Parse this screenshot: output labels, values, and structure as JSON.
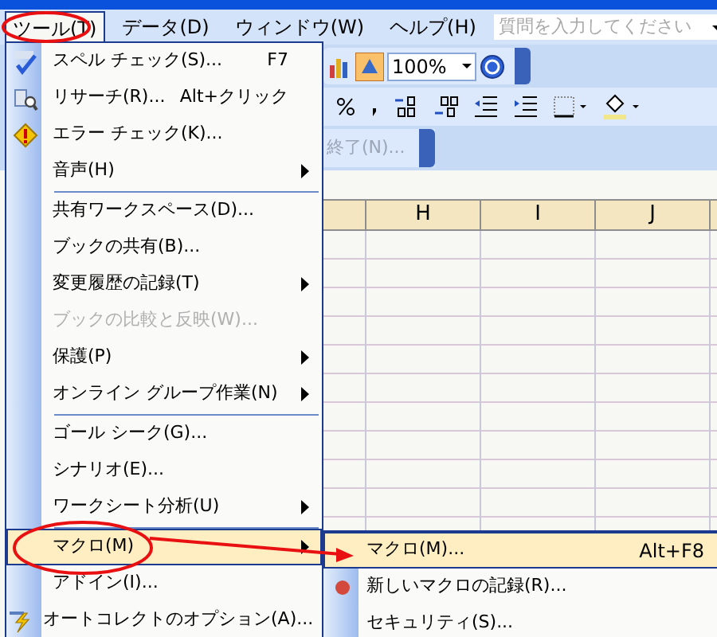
{
  "menu_bar": {
    "items": [
      {
        "label": "ツール(T)",
        "selected": true
      },
      {
        "label": "データ(D)",
        "selected": false
      },
      {
        "label": "ウィンドウ(W)",
        "selected": false
      },
      {
        "label": "ヘルプ(H)",
        "selected": false
      }
    ],
    "question_box": {
      "placeholder": "質問を入力してください"
    }
  },
  "toolbar": {
    "zoom": "100%"
  },
  "review_toolbar": {
    "label": "終了(N)...",
    "disabled": true
  },
  "sheet": {
    "columns": [
      "H",
      "I",
      "J"
    ]
  },
  "tools_menu": [
    {
      "kind": "item",
      "label": "スペル チェック(S)...",
      "shortcut": "F7",
      "submenu": false,
      "disabled": false,
      "selected": false
    },
    {
      "kind": "item",
      "label": "リサーチ(R)...",
      "shortcut": "Alt+クリック",
      "submenu": false,
      "disabled": false,
      "selected": false
    },
    {
      "kind": "item",
      "label": "エラー チェック(K)...",
      "submenu": false,
      "disabled": false,
      "selected": false
    },
    {
      "kind": "item",
      "label": "音声(H)",
      "submenu": true,
      "disabled": false,
      "selected": false
    },
    {
      "kind": "separator"
    },
    {
      "kind": "item",
      "label": "共有ワークスペース(D)...",
      "submenu": false,
      "disabled": false,
      "selected": false
    },
    {
      "kind": "item",
      "label": "ブックの共有(B)...",
      "submenu": false,
      "disabled": false,
      "selected": false
    },
    {
      "kind": "item",
      "label": "変更履歴の記録(T)",
      "submenu": true,
      "disabled": false,
      "selected": false
    },
    {
      "kind": "item",
      "label": "ブックの比較と反映(W)...",
      "submenu": false,
      "disabled": true,
      "selected": false
    },
    {
      "kind": "item",
      "label": "保護(P)",
      "submenu": true,
      "disabled": false,
      "selected": false
    },
    {
      "kind": "item",
      "label": "オンライン グループ作業(N)",
      "submenu": true,
      "disabled": false,
      "selected": false
    },
    {
      "kind": "separator"
    },
    {
      "kind": "item",
      "label": "ゴール シーク(G)...",
      "submenu": false,
      "disabled": false,
      "selected": false
    },
    {
      "kind": "item",
      "label": "シナリオ(E)...",
      "submenu": false,
      "disabled": false,
      "selected": false
    },
    {
      "kind": "item",
      "label": "ワークシート分析(U)",
      "submenu": true,
      "disabled": false,
      "selected": false
    },
    {
      "kind": "separator"
    },
    {
      "kind": "item",
      "label": "マクロ(M)",
      "submenu": true,
      "disabled": false,
      "selected": true
    },
    {
      "kind": "item",
      "label": "アドイン(I)...",
      "submenu": false,
      "disabled": false,
      "selected": false
    },
    {
      "kind": "item",
      "label": "オートコレクトのオプション(A)...",
      "submenu": false,
      "disabled": false,
      "selected": false
    }
  ],
  "macro_submenu": [
    {
      "label": "マクロ(M)...",
      "shortcut": "Alt+F8",
      "selected": true
    },
    {
      "label": "新しいマクロの記録(R)...",
      "selected": false
    },
    {
      "label": "セキュリティ(S)...",
      "selected": false
    }
  ]
}
